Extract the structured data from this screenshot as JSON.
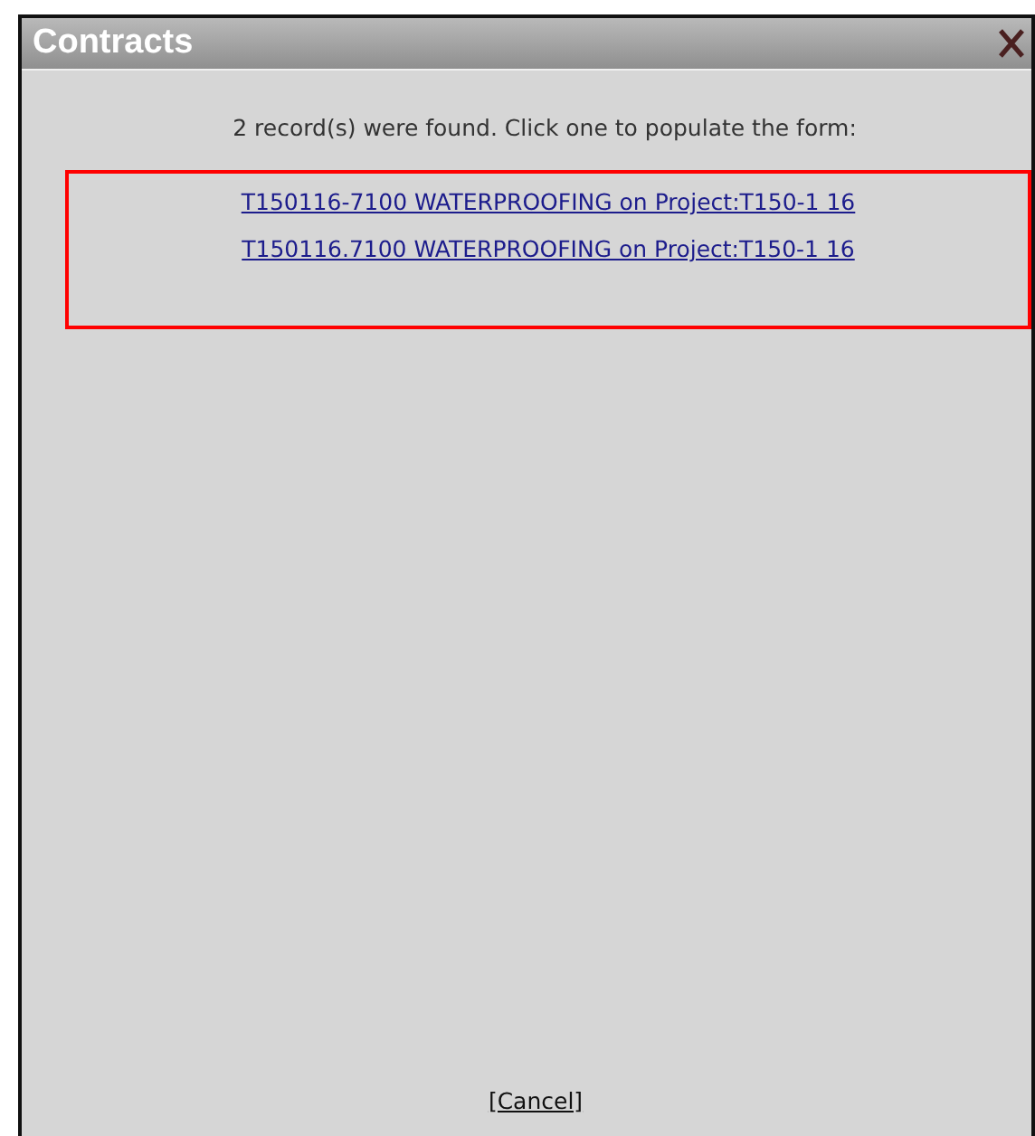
{
  "window": {
    "title": "Contracts"
  },
  "message": "2 record(s) were found. Click one to populate the form:",
  "records": [
    {
      "label": "T150116-7100 WATERPROOFING on Project:T150-1 16"
    },
    {
      "label": "T150116.7100 WATERPROOFING on Project:T150-1 16"
    }
  ],
  "cancel": "[Cancel]"
}
